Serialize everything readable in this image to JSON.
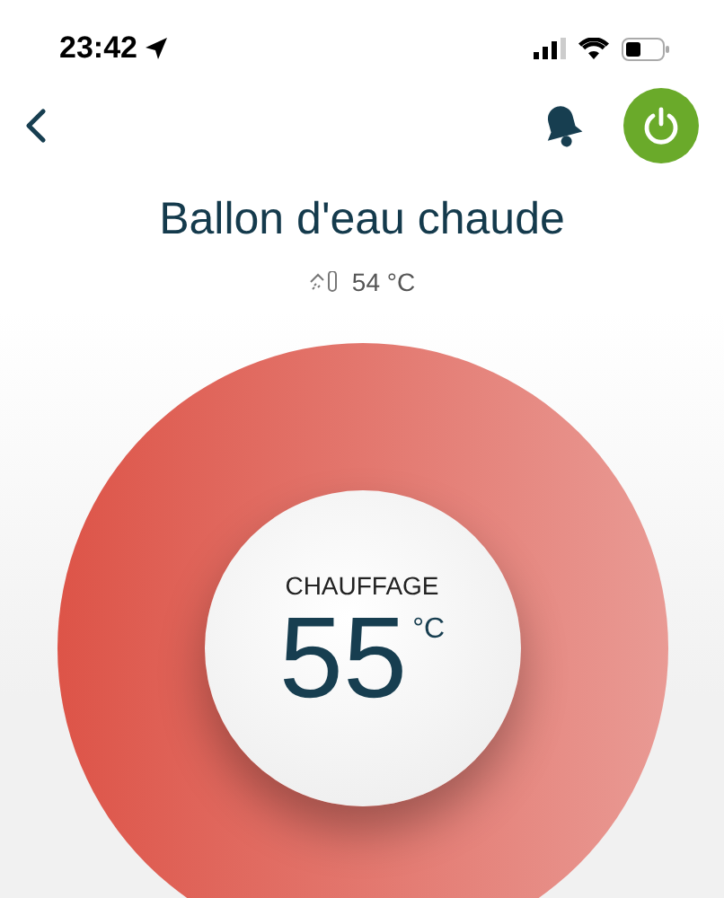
{
  "status_bar": {
    "time": "23:42"
  },
  "header": {
    "power_on": true
  },
  "device": {
    "title": "Ballon d'eau chaude",
    "current_temperature": "54 °C"
  },
  "dial": {
    "mode": "CHAUFFAGE",
    "setpoint": "55",
    "unit": "°C",
    "heating": true
  }
}
